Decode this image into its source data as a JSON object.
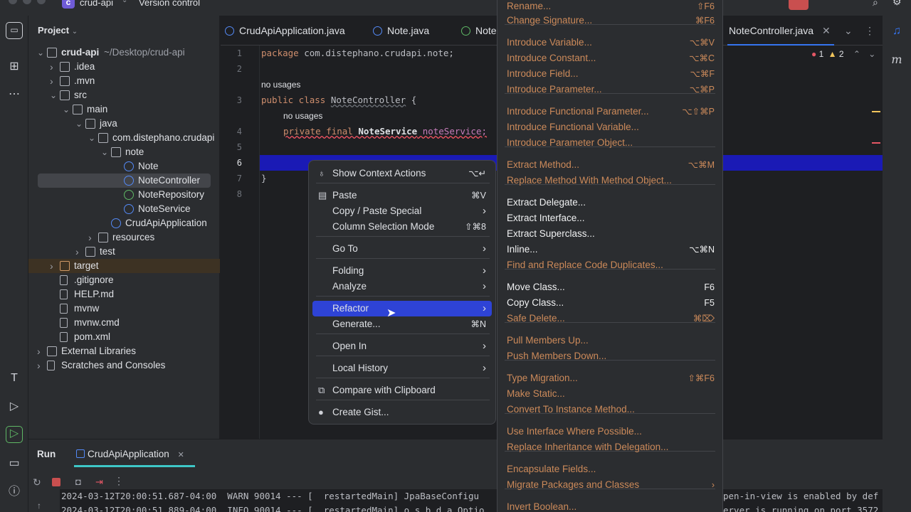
{
  "titlebar": {
    "project_badge": "c",
    "project_name": "crud-api",
    "vcs_label": "Version control"
  },
  "project_panel": {
    "header": "Project",
    "tree": [
      {
        "label": "crud-api",
        "suffix": "~/Desktop/crud-api",
        "icon": "folder-icon",
        "expanded": true
      },
      {
        "label": ".idea",
        "icon": "folder-icon"
      },
      {
        "label": ".mvn",
        "icon": "folder-icon"
      },
      {
        "label": "src",
        "icon": "folder-icon",
        "expanded": true
      },
      {
        "label": "main",
        "icon": "folder-icon",
        "expanded": true
      },
      {
        "label": "java",
        "icon": "folder-icon",
        "expanded": true
      },
      {
        "label": "com.distephano.crudapi",
        "icon": "package-icon",
        "expanded": true
      },
      {
        "label": "note",
        "icon": "package-icon",
        "expanded": true
      },
      {
        "label": "Note",
        "icon": "class-icon"
      },
      {
        "label": "NoteController",
        "icon": "class-icon",
        "selected": true
      },
      {
        "label": "NoteRepository",
        "icon": "interface-icon"
      },
      {
        "label": "NoteService",
        "icon": "class-icon"
      },
      {
        "label": "CrudApiApplication",
        "icon": "class-icon"
      },
      {
        "label": "resources",
        "icon": "folder-icon"
      },
      {
        "label": "test",
        "icon": "folder-icon"
      },
      {
        "label": "target",
        "icon": "folder-icon",
        "excluded": true
      },
      {
        "label": ".gitignore",
        "icon": "gitignore-icon"
      },
      {
        "label": "HELP.md",
        "icon": "markdown-icon"
      },
      {
        "label": "mvnw",
        "icon": "file-icon"
      },
      {
        "label": "mvnw.cmd",
        "icon": "file-icon"
      },
      {
        "label": "pom.xml",
        "icon": "maven-icon"
      },
      {
        "label": "External Libraries",
        "icon": "library-icon"
      },
      {
        "label": "Scratches and Consoles",
        "icon": "scratches-icon"
      }
    ]
  },
  "editor": {
    "tabs": [
      "CrudApiApplication.java",
      "Note.java",
      "Note",
      "NoteController.java"
    ],
    "errors": "1",
    "warnings": "2",
    "lines": [
      "1",
      "2",
      "3",
      "4",
      "5",
      "6",
      "7",
      "8"
    ],
    "hint_no_usages": "no usages",
    "code": {
      "l1_kw": "package",
      "l1_rest": " com.distephano.crudapi.note;",
      "l3_kw": "public class",
      "l3_name": "NoteController",
      "l3_rest": " {",
      "l4_kw": "private final",
      "l4_type": "NoteService",
      "l4_rest": " noteService;",
      "l7": "}"
    }
  },
  "context_menu": {
    "items": [
      {
        "label": "Show Context Actions",
        "shortcut": "⌥↵",
        "icon": "bulb-icon"
      },
      {
        "label": "Paste",
        "shortcut": "⌘V",
        "icon": "paste-icon"
      },
      {
        "label": "Copy / Paste Special",
        "submenu": true
      },
      {
        "label": "Column Selection Mode",
        "shortcut": "⇧⌘8"
      },
      {
        "label": "Go To",
        "submenu": true
      },
      {
        "label": "Folding",
        "submenu": true
      },
      {
        "label": "Analyze",
        "submenu": true
      },
      {
        "label": "Refactor",
        "submenu": true,
        "selected": true
      },
      {
        "label": "Generate...",
        "shortcut": "⌘N"
      },
      {
        "label": "Open In",
        "submenu": true
      },
      {
        "label": "Local History",
        "submenu": true
      },
      {
        "label": "Compare with Clipboard",
        "icon": "compare-icon"
      },
      {
        "label": "Create Gist...",
        "icon": "github-icon"
      }
    ]
  },
  "refactor_menu": {
    "items": [
      {
        "label": "Rename...",
        "shortcut": "⇧F6",
        "dim": true
      },
      {
        "label": "Change Signature...",
        "shortcut": "⌘F6",
        "dim": true
      },
      {
        "label": "Introduce Variable...",
        "shortcut": "⌥⌘V",
        "dim": true
      },
      {
        "label": "Introduce Constant...",
        "shortcut": "⌥⌘C",
        "dim": true
      },
      {
        "label": "Introduce Field...",
        "shortcut": "⌥⌘F",
        "dim": true
      },
      {
        "label": "Introduce Parameter...",
        "shortcut": "⌥⌘P",
        "dim": true
      },
      {
        "label": "Introduce Functional Parameter...",
        "shortcut": "⌥⇧⌘P",
        "dim": true
      },
      {
        "label": "Introduce Functional Variable...",
        "shortcut": "",
        "dim": true
      },
      {
        "label": "Introduce Parameter Object...",
        "shortcut": "",
        "dim": true
      },
      {
        "label": "Extract Method...",
        "shortcut": "⌥⌘M",
        "dim": true
      },
      {
        "label": "Replace Method With Method Object...",
        "shortcut": "",
        "dim": true
      },
      {
        "label": "Extract Delegate...",
        "shortcut": "",
        "dim": false
      },
      {
        "label": "Extract Interface...",
        "shortcut": "",
        "dim": false
      },
      {
        "label": "Extract Superclass...",
        "shortcut": "",
        "dim": false
      },
      {
        "label": "Inline...",
        "shortcut": "⌥⌘N",
        "dim": false
      },
      {
        "label": "Find and Replace Code Duplicates...",
        "shortcut": "",
        "dim": true
      },
      {
        "label": "Move Class...",
        "shortcut": "F6",
        "dim": false
      },
      {
        "label": "Copy Class...",
        "shortcut": "F5",
        "dim": false
      },
      {
        "label": "Safe Delete...",
        "shortcut": "⌘⌦",
        "dim": true
      },
      {
        "label": "Pull Members Up...",
        "shortcut": "",
        "dim": true
      },
      {
        "label": "Push Members Down...",
        "shortcut": "",
        "dim": true
      },
      {
        "label": "Type Migration...",
        "shortcut": "⇧⌘F6",
        "dim": true
      },
      {
        "label": "Make Static...",
        "shortcut": "",
        "dim": true
      },
      {
        "label": "Convert To Instance Method...",
        "shortcut": "",
        "dim": true
      },
      {
        "label": "Use Interface Where Possible...",
        "shortcut": "",
        "dim": true
      },
      {
        "label": "Replace Inheritance with Delegation...",
        "shortcut": "",
        "dim": true
      },
      {
        "label": "Encapsulate Fields...",
        "shortcut": "",
        "dim": true
      },
      {
        "label": "Migrate Packages and Classes",
        "shortcut": "›",
        "dim": true
      },
      {
        "label": "Invert Boolean...",
        "shortcut": "",
        "dim": true
      }
    ]
  },
  "run_panel": {
    "title": "Run",
    "config_tab": "CrudApiApplication",
    "log": [
      "2024-03-12T20:00:51.687-04:00  WARN 90014 --- [  restartedMain] JpaBaseConfigu",
      "2024-03-12T20:00:51.889-04:00  INFO 90014 --- [  restartedMain] o.s.b.d.a.Optio"
    ],
    "log_right": [
      "pen-in-view is enabled by def",
      "erver is running on port 3572"
    ]
  }
}
